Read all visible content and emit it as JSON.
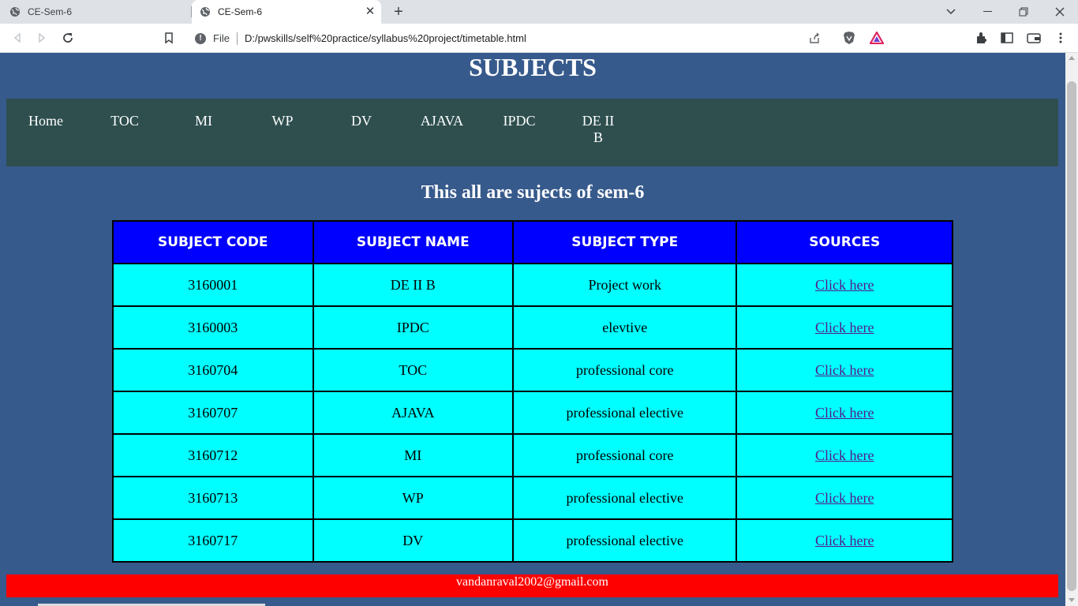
{
  "browser": {
    "tabs": [
      {
        "title": "CE-Sem-6",
        "active": false
      },
      {
        "title": "CE-Sem-6",
        "active": true
      }
    ],
    "scheme_label": "File",
    "url": "D:/pwskills/self%20practice/syllabus%20project/timetable.html"
  },
  "page": {
    "title": "SUBJECTS",
    "nav": [
      {
        "label": "Home"
      },
      {
        "label": "TOC"
      },
      {
        "label": "MI"
      },
      {
        "label": "WP"
      },
      {
        "label": "DV"
      },
      {
        "label": "AJAVA"
      },
      {
        "label": "IPDC"
      },
      {
        "label": "DE II B"
      }
    ],
    "subtitle": "This all are sujects of sem-6",
    "table": {
      "headers": [
        "SUBJECT CODE",
        "SUBJECT NAME",
        "SUBJECT TYPE",
        "SOURCES"
      ],
      "rows": [
        {
          "code": "3160001",
          "name": "DE II B",
          "type": "Project work",
          "source": "Click here"
        },
        {
          "code": "3160003",
          "name": "IPDC",
          "type": "elevtive",
          "source": "Click here"
        },
        {
          "code": "3160704",
          "name": "TOC",
          "type": "professional core",
          "source": "Click here"
        },
        {
          "code": "3160707",
          "name": "AJAVA",
          "type": "professional elective",
          "source": "Click here"
        },
        {
          "code": "3160712",
          "name": "MI",
          "type": "professional core",
          "source": "Click here"
        },
        {
          "code": "3160713",
          "name": "WP",
          "type": "professional elective",
          "source": "Click here"
        },
        {
          "code": "3160717",
          "name": "DV",
          "type": "professional elective",
          "source": "Click here"
        }
      ]
    },
    "footer": "vandanraval2002@gmail.com"
  },
  "colors": {
    "page_bg": "#375a8c",
    "nav_bg": "#2f4f4f",
    "header_bg": "#0000ff",
    "cell_bg": "#00ffff",
    "footer_bg": "#ff0000",
    "link": "#551a8b"
  }
}
